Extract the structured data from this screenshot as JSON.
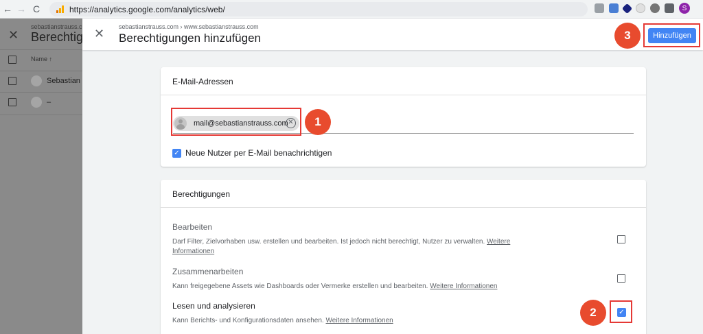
{
  "browser": {
    "back": "←",
    "forward": "→",
    "reload": "C",
    "url": "https://analytics.google.com/analytics/web/",
    "profile_initial": "S"
  },
  "background_page": {
    "breadcrumb": "sebastianstrauss.com",
    "title": "Berechtigungsverwaltung",
    "close": "✕",
    "column_name": "Name ↑",
    "rows": [
      "Sebastian Strauss",
      "–"
    ]
  },
  "dialog": {
    "close": "✕",
    "breadcrumb": "sebastianstrauss.com › www.sebastianstrauss.com",
    "title": "Berechtigungen hinzufügen",
    "add_button": "Hinzufügen",
    "email_card": {
      "title": "E-Mail-Adressen",
      "chip_email": "mail@sebastianstrauss.com",
      "chip_remove": "✕",
      "notify_checked": true,
      "notify_label": "Neue Nutzer per E-Mail benachrichtigen"
    },
    "permissions_card": {
      "title": "Berechtigungen",
      "more_info": "Weitere Informationen",
      "items": [
        {
          "name": "Bearbeiten",
          "description_line1": "Darf Filter, Zielvorhaben usw. erstellen und bearbeiten. Ist jedoch nicht berechtigt, Nutzer zu verwalten.",
          "more_line1": "Weitere",
          "more_line2": "Informationen",
          "checked": false
        },
        {
          "name": "Zusammenarbeiten",
          "description": "Kann freigegebene Assets wie Dashboards oder Vermerke erstellen und bearbeiten.",
          "more": "Weitere Informationen",
          "checked": false
        },
        {
          "name": "Lesen und analysieren",
          "description": "Kann Berichts- und Konfigurationsdaten ansehen.",
          "more": "Weitere Informationen",
          "checked": true
        }
      ]
    }
  },
  "annotations": {
    "badge_1": "1",
    "badge_2": "2",
    "badge_3": "3"
  },
  "colors": {
    "accent": "#4285f4",
    "highlight": "#e53935",
    "badge": "#e84b2e"
  }
}
